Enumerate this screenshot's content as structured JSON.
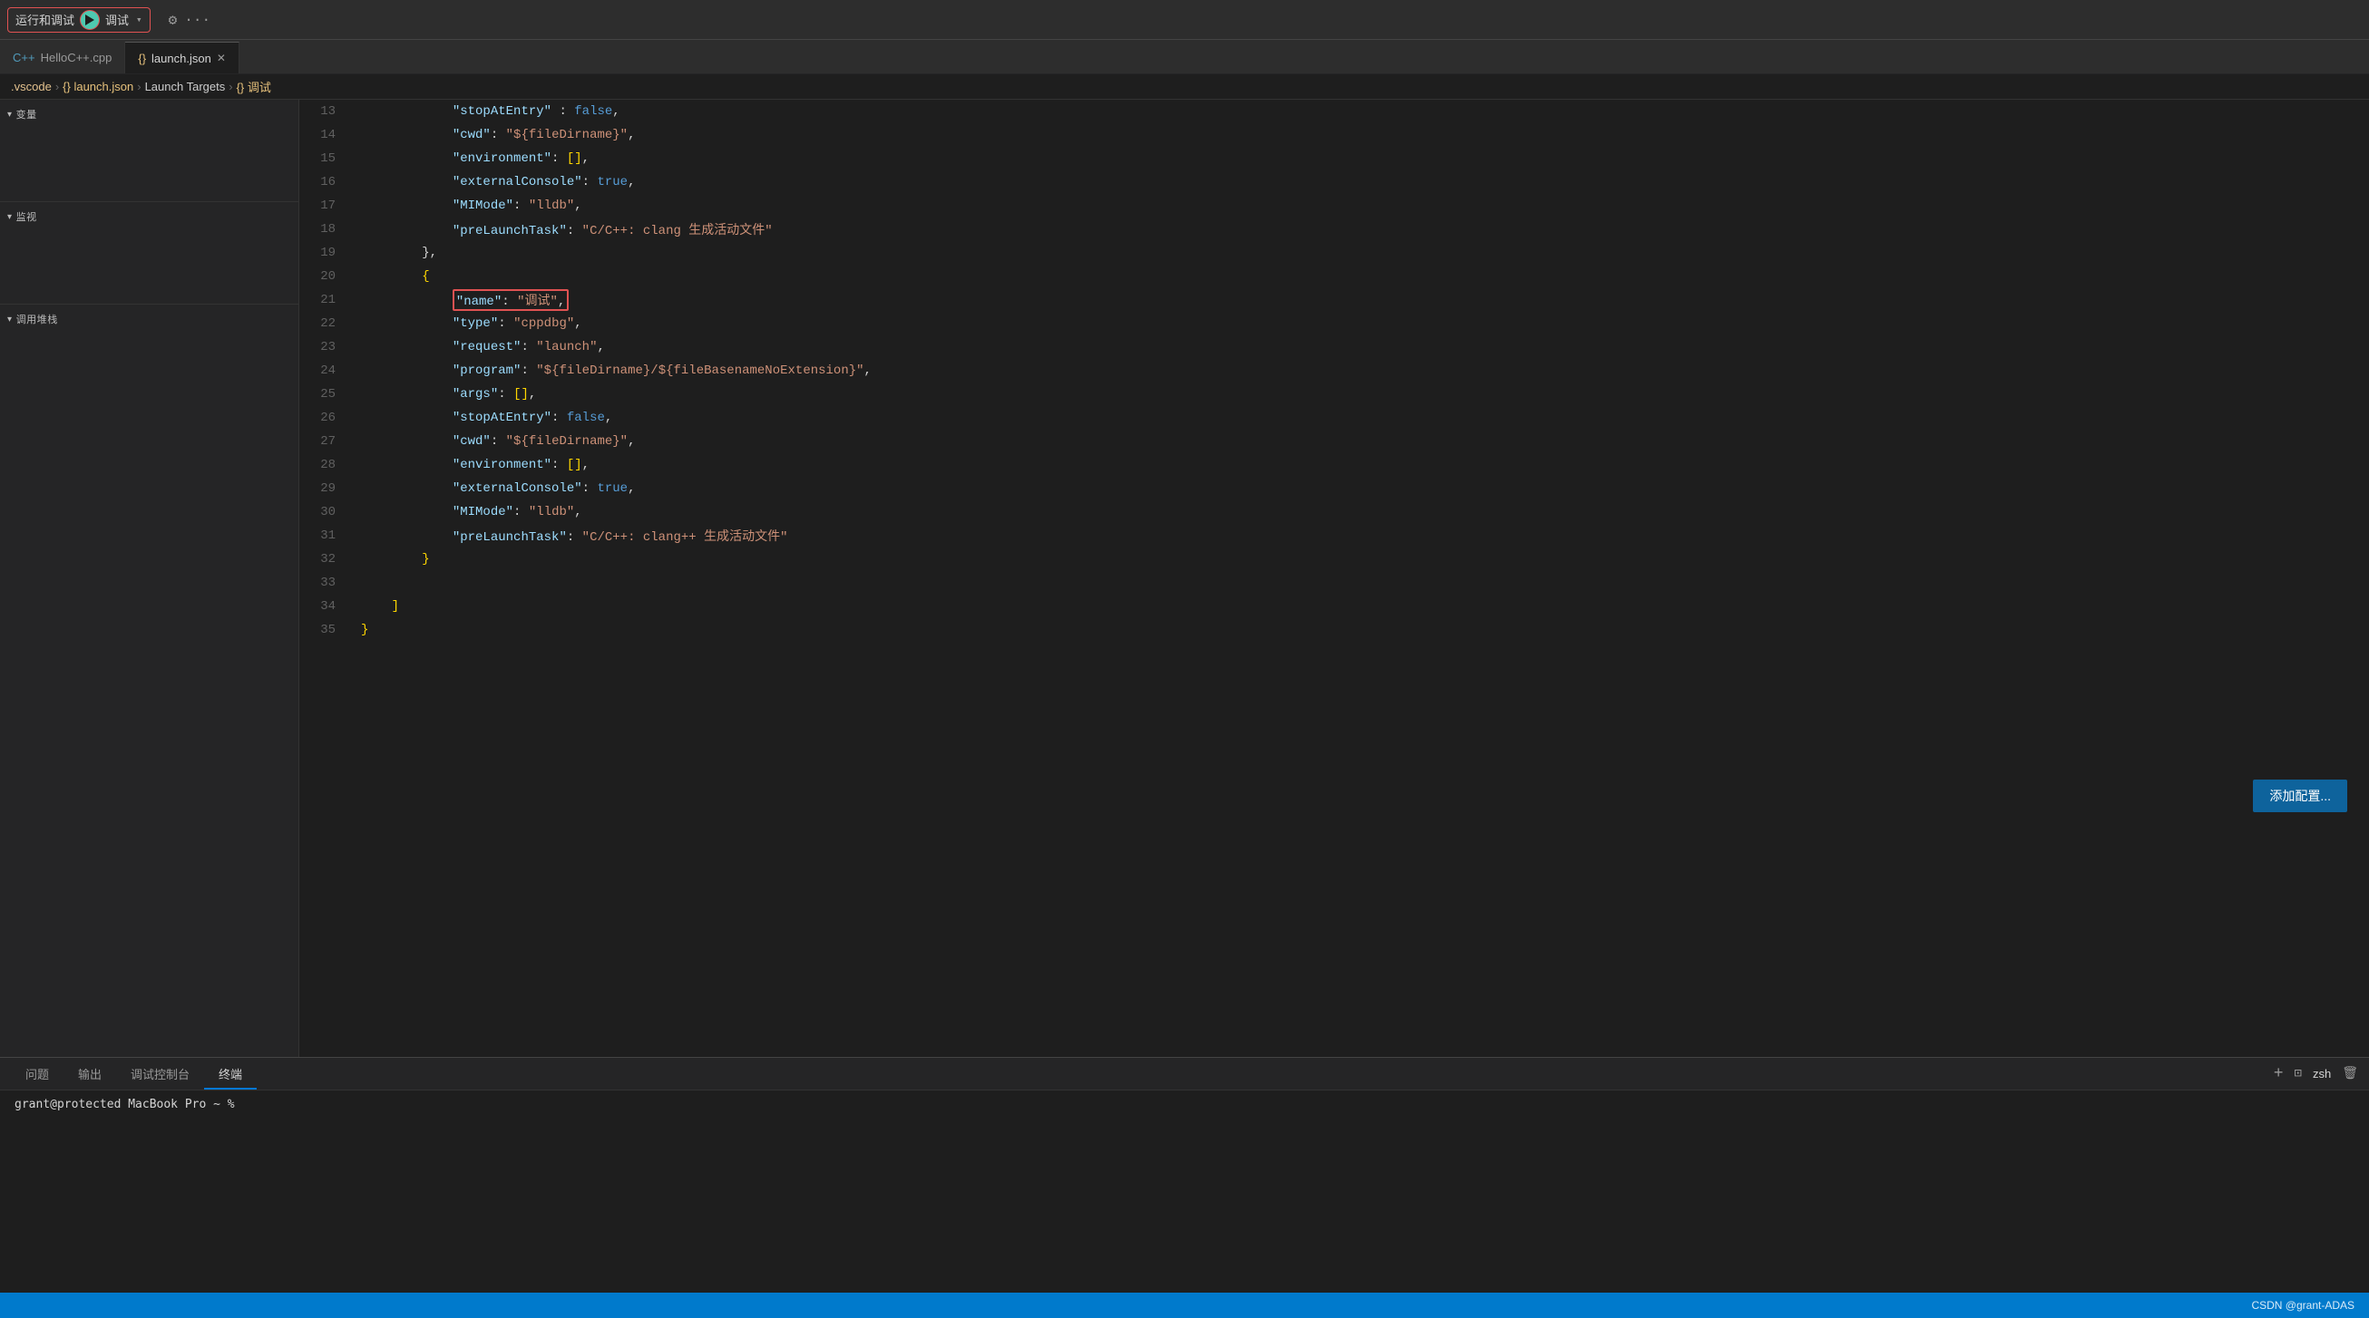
{
  "topbar": {
    "run_debug_label": "运行和调试",
    "debug_config": "调试",
    "gear_label": "⚙",
    "ellipsis_label": "···"
  },
  "tabs": [
    {
      "id": "hello-cpp",
      "icon": "C++",
      "label": "HelloC++.cpp",
      "active": false,
      "closable": false
    },
    {
      "id": "launch-json",
      "icon": "{}",
      "label": "launch.json",
      "active": true,
      "closable": true
    }
  ],
  "breadcrumb": {
    "items": [
      ".vscode",
      "launch.json",
      "Launch Targets",
      "{} 调试"
    ]
  },
  "sidebar": {
    "variables_section": {
      "label": "变量"
    },
    "watch_section": {
      "label": "监视"
    },
    "callstack_section": {
      "label": "调用堆栈"
    }
  },
  "code": {
    "lines": [
      {
        "num": 13,
        "tokens": [
          {
            "t": "            ",
            "c": ""
          },
          {
            "t": "\"stopAtEntry\"",
            "c": "key"
          },
          {
            "t": " : ",
            "c": "punct"
          },
          {
            "t": "false",
            "c": "bool-val"
          },
          {
            "t": ",",
            "c": "punct"
          }
        ]
      },
      {
        "num": 14,
        "tokens": [
          {
            "t": "            ",
            "c": ""
          },
          {
            "t": "\"cwd\"",
            "c": "key"
          },
          {
            "t": ": ",
            "c": "punct"
          },
          {
            "t": "\"${fileDirname}\"",
            "c": "str-val"
          },
          {
            "t": ",",
            "c": "punct"
          }
        ]
      },
      {
        "num": 15,
        "tokens": [
          {
            "t": "            ",
            "c": ""
          },
          {
            "t": "\"environment\"",
            "c": "key"
          },
          {
            "t": ": ",
            "c": "punct"
          },
          {
            "t": "[]",
            "c": "bracket"
          },
          {
            "t": ",",
            "c": "punct"
          }
        ]
      },
      {
        "num": 16,
        "tokens": [
          {
            "t": "            ",
            "c": ""
          },
          {
            "t": "\"externalConsole\"",
            "c": "key"
          },
          {
            "t": ": ",
            "c": "punct"
          },
          {
            "t": "true",
            "c": "bool-val"
          },
          {
            "t": ",",
            "c": "punct"
          }
        ]
      },
      {
        "num": 17,
        "tokens": [
          {
            "t": "            ",
            "c": ""
          },
          {
            "t": "\"MIMode\"",
            "c": "key"
          },
          {
            "t": ": ",
            "c": "punct"
          },
          {
            "t": "\"lldb\"",
            "c": "str-val"
          },
          {
            "t": ",",
            "c": "punct"
          }
        ]
      },
      {
        "num": 18,
        "tokens": [
          {
            "t": "            ",
            "c": ""
          },
          {
            "t": "\"preLaunchTask\"",
            "c": "key"
          },
          {
            "t": ": ",
            "c": "punct"
          },
          {
            "t": "\"C/C++: clang 生成活动文件\"",
            "c": "str-val"
          }
        ]
      },
      {
        "num": 19,
        "tokens": [
          {
            "t": "        ",
            "c": ""
          },
          {
            "t": "},",
            "c": "punct"
          }
        ]
      },
      {
        "num": 20,
        "tokens": [
          {
            "t": "        ",
            "c": ""
          },
          {
            "t": "{",
            "c": "bracket"
          }
        ]
      },
      {
        "num": 21,
        "highlight": true,
        "tokens": [
          {
            "t": "            ",
            "c": ""
          },
          {
            "t": "\"name\"",
            "c": "key"
          },
          {
            "t": ": ",
            "c": "punct"
          },
          {
            "t": "\"调试\"",
            "c": "str-val"
          },
          {
            "t": ",",
            "c": "punct"
          }
        ]
      },
      {
        "num": 22,
        "tokens": [
          {
            "t": "            ",
            "c": ""
          },
          {
            "t": "\"type\"",
            "c": "key"
          },
          {
            "t": ": ",
            "c": "punct"
          },
          {
            "t": "\"cppdbg\"",
            "c": "str-val"
          },
          {
            "t": ",",
            "c": "punct"
          }
        ]
      },
      {
        "num": 23,
        "tokens": [
          {
            "t": "            ",
            "c": ""
          },
          {
            "t": "\"request\"",
            "c": "key"
          },
          {
            "t": ": ",
            "c": "punct"
          },
          {
            "t": "\"launch\"",
            "c": "str-val"
          },
          {
            "t": ",",
            "c": "punct"
          }
        ]
      },
      {
        "num": 24,
        "tokens": [
          {
            "t": "            ",
            "c": ""
          },
          {
            "t": "\"program\"",
            "c": "key"
          },
          {
            "t": ": ",
            "c": "punct"
          },
          {
            "t": "\"${fileDirname}/${fileBasenameNoExtension}\"",
            "c": "str-val"
          },
          {
            "t": ",",
            "c": "punct"
          }
        ]
      },
      {
        "num": 25,
        "tokens": [
          {
            "t": "            ",
            "c": ""
          },
          {
            "t": "\"args\"",
            "c": "key"
          },
          {
            "t": ": ",
            "c": "punct"
          },
          {
            "t": "[]",
            "c": "bracket"
          },
          {
            "t": ",",
            "c": "punct"
          }
        ]
      },
      {
        "num": 26,
        "tokens": [
          {
            "t": "            ",
            "c": ""
          },
          {
            "t": "\"stopAtEntry\"",
            "c": "key"
          },
          {
            "t": ": ",
            "c": "punct"
          },
          {
            "t": "false",
            "c": "bool-val"
          },
          {
            "t": ",",
            "c": "punct"
          }
        ]
      },
      {
        "num": 27,
        "tokens": [
          {
            "t": "            ",
            "c": ""
          },
          {
            "t": "\"cwd\"",
            "c": "key"
          },
          {
            "t": ": ",
            "c": "punct"
          },
          {
            "t": "\"${fileDirname}\"",
            "c": "str-val"
          },
          {
            "t": ",",
            "c": "punct"
          }
        ]
      },
      {
        "num": 28,
        "tokens": [
          {
            "t": "            ",
            "c": ""
          },
          {
            "t": "\"environment\"",
            "c": "key"
          },
          {
            "t": ": ",
            "c": "punct"
          },
          {
            "t": "[]",
            "c": "bracket"
          },
          {
            "t": ",",
            "c": "punct"
          }
        ]
      },
      {
        "num": 29,
        "tokens": [
          {
            "t": "            ",
            "c": ""
          },
          {
            "t": "\"externalConsole\"",
            "c": "key"
          },
          {
            "t": ": ",
            "c": "punct"
          },
          {
            "t": "true",
            "c": "bool-val"
          },
          {
            "t": ",",
            "c": "punct"
          }
        ]
      },
      {
        "num": 30,
        "tokens": [
          {
            "t": "            ",
            "c": ""
          },
          {
            "t": "\"MIMode\"",
            "c": "key"
          },
          {
            "t": ": ",
            "c": "punct"
          },
          {
            "t": "\"lldb\"",
            "c": "str-val"
          },
          {
            "t": ",",
            "c": "punct"
          }
        ]
      },
      {
        "num": 31,
        "tokens": [
          {
            "t": "            ",
            "c": ""
          },
          {
            "t": "\"preLaunchTask\"",
            "c": "key"
          },
          {
            "t": ": ",
            "c": "punct"
          },
          {
            "t": "\"C/C++: clang++ 生成活动文件\"",
            "c": "str-val"
          }
        ]
      },
      {
        "num": 32,
        "tokens": [
          {
            "t": "        ",
            "c": ""
          },
          {
            "t": "}",
            "c": "bracket"
          }
        ]
      },
      {
        "num": 33,
        "tokens": []
      },
      {
        "num": 34,
        "tokens": [
          {
            "t": "    ",
            "c": ""
          },
          {
            "t": "]",
            "c": "bracket"
          }
        ]
      },
      {
        "num": 35,
        "tokens": [
          {
            "t": "}",
            "c": "bracket"
          }
        ]
      }
    ]
  },
  "panel": {
    "tabs": [
      {
        "id": "problems",
        "label": "问题"
      },
      {
        "id": "output",
        "label": "输出"
      },
      {
        "id": "debug-console",
        "label": "调试控制台"
      },
      {
        "id": "terminal",
        "label": "终端",
        "active": true
      }
    ],
    "terminal_line": "grant@protected MacBook Pro ~ % "
  },
  "add_config_btn": "添加配置...",
  "statusbar": {
    "csdn": "CSDN @grant-ADAS",
    "shell_label": "zsh",
    "plus_icon": "+",
    "split_icon": "⊡",
    "delete_icon": "🗑"
  }
}
